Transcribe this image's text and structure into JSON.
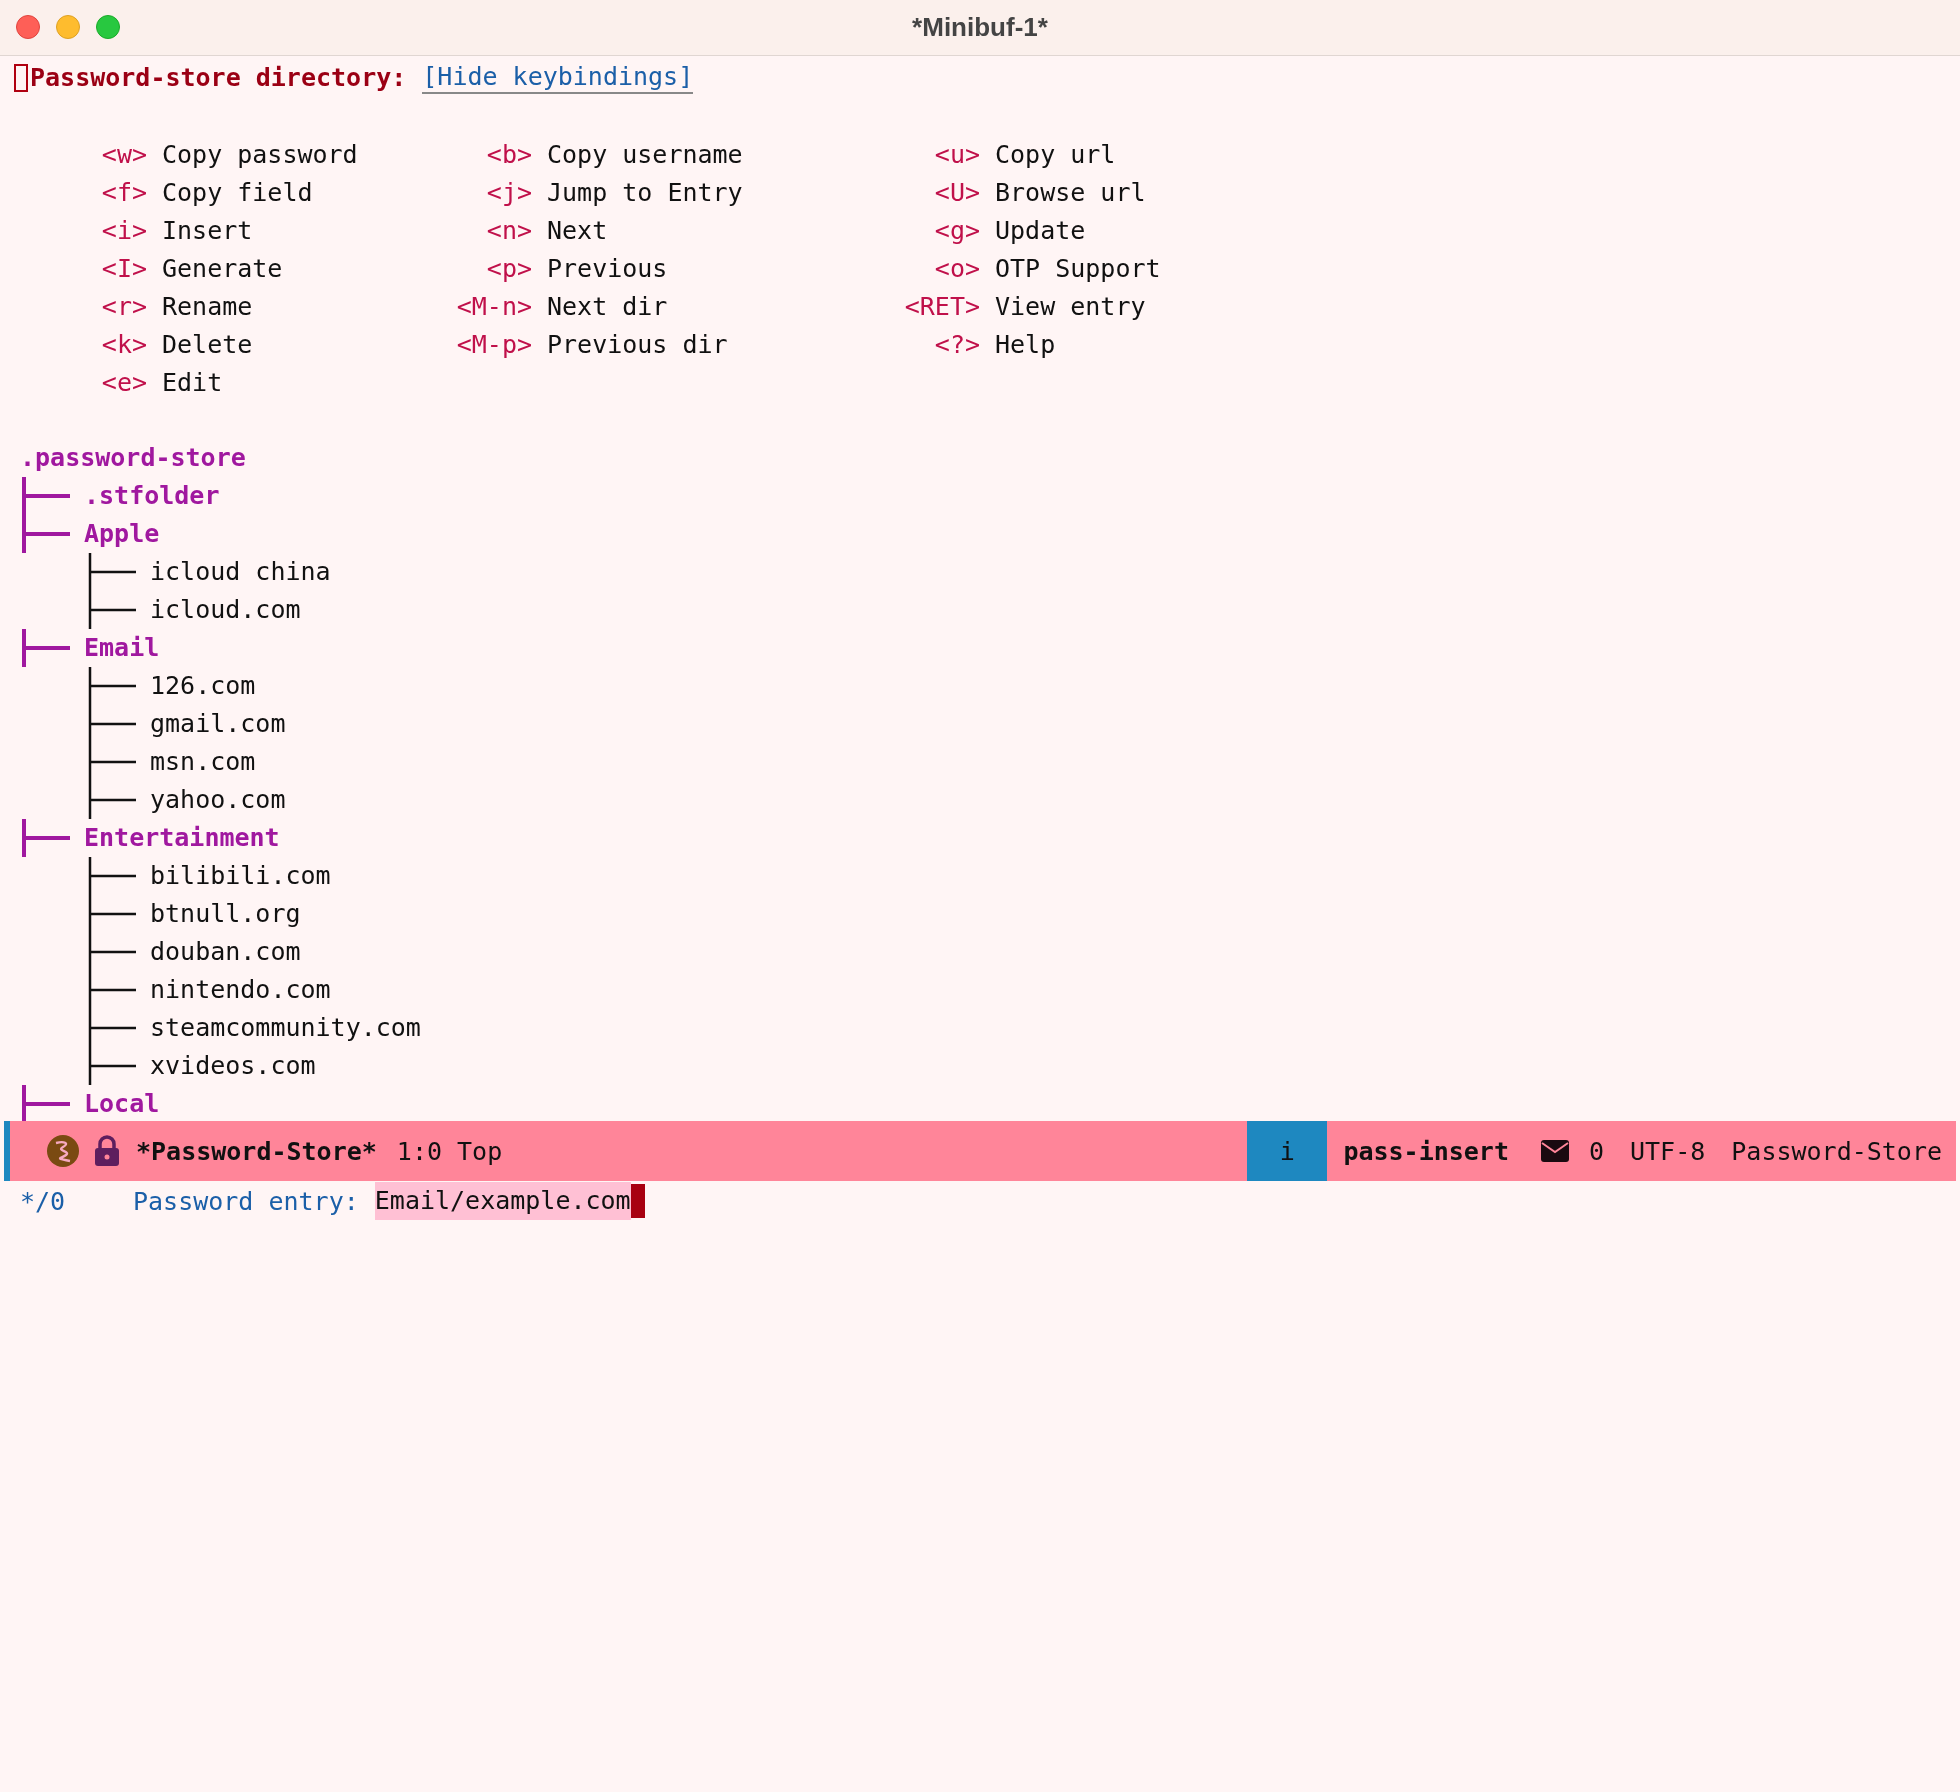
{
  "window": {
    "title": "*Minibuf-1*"
  },
  "header": {
    "title": "Password-store directory:",
    "link": "[Hide keybindings]"
  },
  "keybindings": [
    [
      {
        "key": "<w>",
        "action": "Copy password"
      },
      {
        "key": "<f>",
        "action": "Copy field"
      },
      {
        "key": "<i>",
        "action": "Insert"
      },
      {
        "key": "<I>",
        "action": "Generate"
      },
      {
        "key": "<r>",
        "action": "Rename"
      },
      {
        "key": "<k>",
        "action": "Delete"
      },
      {
        "key": "<e>",
        "action": "Edit"
      }
    ],
    [
      {
        "key": "<b>",
        "action": "Copy username"
      },
      {
        "key": "<j>",
        "action": "Jump to Entry"
      },
      {
        "key": "<n>",
        "action": "Next"
      },
      {
        "key": "<p>",
        "action": "Previous"
      },
      {
        "key": "<M-n>",
        "action": "Next dir"
      },
      {
        "key": "<M-p>",
        "action": "Previous dir"
      }
    ],
    [
      {
        "key": "<u>",
        "action": "Copy url"
      },
      {
        "key": "<U>",
        "action": "Browse url"
      },
      {
        "key": "<g>",
        "action": "Update"
      },
      {
        "key": "<o>",
        "action": "OTP Support"
      },
      {
        "key": "<RET>",
        "action": "View entry"
      },
      {
        "key": "<?>",
        "action": "Help"
      }
    ]
  ],
  "tree": {
    "root": ".password-store",
    "children": [
      {
        "name": ".stfolder",
        "kind": "dir"
      },
      {
        "name": "Apple",
        "kind": "dir",
        "children": [
          {
            "name": "icloud china",
            "kind": "entry"
          },
          {
            "name": "icloud.com",
            "kind": "entry"
          }
        ]
      },
      {
        "name": "Email",
        "kind": "dir",
        "children": [
          {
            "name": "126.com",
            "kind": "entry"
          },
          {
            "name": "gmail.com",
            "kind": "entry"
          },
          {
            "name": "msn.com",
            "kind": "entry"
          },
          {
            "name": "yahoo.com",
            "kind": "entry"
          }
        ]
      },
      {
        "name": "Entertainment",
        "kind": "dir",
        "children": [
          {
            "name": "bilibili.com",
            "kind": "entry"
          },
          {
            "name": "btnull.org",
            "kind": "entry"
          },
          {
            "name": "douban.com",
            "kind": "entry"
          },
          {
            "name": "nintendo.com",
            "kind": "entry"
          },
          {
            "name": "steamcommunity.com",
            "kind": "entry"
          },
          {
            "name": "xvideos.com",
            "kind": "entry"
          }
        ]
      },
      {
        "name": "Local",
        "kind": "dir"
      }
    ]
  },
  "mode_line": {
    "buffer": "*Password-Store*",
    "position": "1:0 Top",
    "state": "i",
    "major_mode": "pass-insert",
    "mail_count": "0",
    "encoding": "UTF-8",
    "mode_name": "Password-Store"
  },
  "minibuffer": {
    "depth": "*/0",
    "prompt": "Password entry:",
    "value": "Email/example.com"
  }
}
